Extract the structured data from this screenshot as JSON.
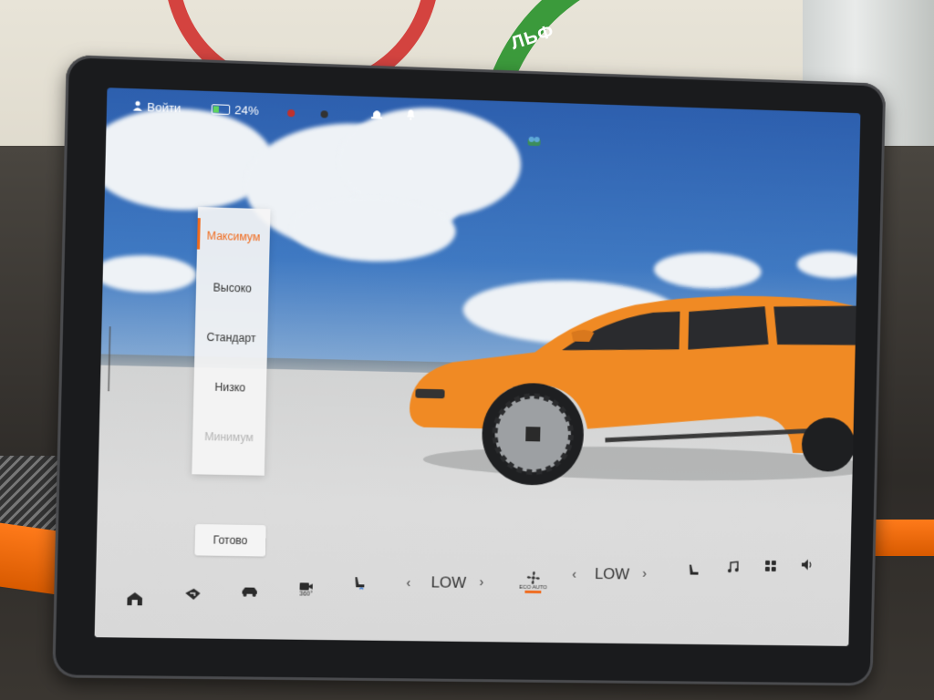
{
  "background_sign": {
    "text": "ЛЬФ"
  },
  "statusbar": {
    "login_label": "Войти",
    "battery_percent": "24%"
  },
  "picker": {
    "items": [
      "Максимум",
      "Высоко",
      "Стандарт",
      "Низко",
      "Минимум"
    ],
    "selected_index": 0
  },
  "done_label": "Готово",
  "dock": {
    "fan_left_value": "LOW",
    "fan_right_value": "LOW",
    "eco_label": "ECO AUTO",
    "camera_label": "360°"
  },
  "colors": {
    "accent": "#f06a1c",
    "car_body": "#f08a24"
  }
}
